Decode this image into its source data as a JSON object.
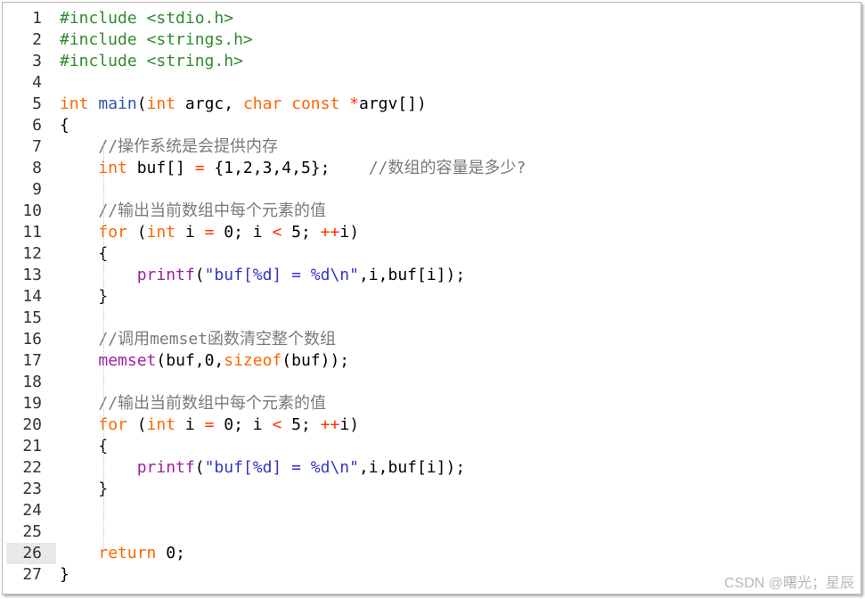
{
  "editor": {
    "lines": [
      {
        "n": "1",
        "tokens": [
          [
            "pp",
            "#include <stdio.h>"
          ]
        ]
      },
      {
        "n": "2",
        "tokens": [
          [
            "pp",
            "#include <strings.h>"
          ]
        ]
      },
      {
        "n": "3",
        "tokens": [
          [
            "pp",
            "#include <string.h>"
          ]
        ]
      },
      {
        "n": "4",
        "tokens": []
      },
      {
        "n": "5",
        "tokens": [
          [
            "kw",
            "int"
          ],
          [
            "t",
            " "
          ],
          [
            "fn",
            "main"
          ],
          [
            "t",
            "("
          ],
          [
            "kw",
            "int"
          ],
          [
            "t",
            " argc, "
          ],
          [
            "kw",
            "char const"
          ],
          [
            "t",
            " "
          ],
          [
            "op",
            "*"
          ],
          [
            "t",
            "argv[])"
          ]
        ]
      },
      {
        "n": "6",
        "tokens": [
          [
            "t",
            "{"
          ]
        ]
      },
      {
        "n": "7",
        "tokens": [
          [
            "t",
            "    "
          ],
          [
            "cm",
            "//操作系统是会提供内存"
          ]
        ]
      },
      {
        "n": "8",
        "tokens": [
          [
            "t",
            "    "
          ],
          [
            "kw",
            "int"
          ],
          [
            "t",
            " buf[] "
          ],
          [
            "op",
            "="
          ],
          [
            "t",
            " {1,2,3,4,5};    "
          ],
          [
            "cm",
            "//数组的容量是多少?"
          ]
        ]
      },
      {
        "n": "9",
        "tokens": []
      },
      {
        "n": "10",
        "tokens": [
          [
            "t",
            "    "
          ],
          [
            "cm",
            "//输出当前数组中每个元素的值"
          ]
        ]
      },
      {
        "n": "11",
        "tokens": [
          [
            "t",
            "    "
          ],
          [
            "kw",
            "for"
          ],
          [
            "t",
            " ("
          ],
          [
            "kw",
            "int"
          ],
          [
            "t",
            " i "
          ],
          [
            "op",
            "="
          ],
          [
            "t",
            " 0; i "
          ],
          [
            "op",
            "<"
          ],
          [
            "t",
            " 5; "
          ],
          [
            "op",
            "++"
          ],
          [
            "t",
            "i)"
          ]
        ]
      },
      {
        "n": "12",
        "tokens": [
          [
            "t",
            "    {"
          ]
        ]
      },
      {
        "n": "13",
        "tokens": [
          [
            "t",
            "        "
          ],
          [
            "call",
            "printf"
          ],
          [
            "t",
            "("
          ],
          [
            "str",
            "\"buf[%d] = %d\\n\""
          ],
          [
            "t",
            ",i,buf[i]);"
          ]
        ]
      },
      {
        "n": "14",
        "tokens": [
          [
            "t",
            "    }"
          ]
        ]
      },
      {
        "n": "15",
        "tokens": []
      },
      {
        "n": "16",
        "tokens": [
          [
            "t",
            "    "
          ],
          [
            "cm",
            "//调用memset函数清空整个数组"
          ]
        ]
      },
      {
        "n": "17",
        "tokens": [
          [
            "t",
            "    "
          ],
          [
            "call",
            "memset"
          ],
          [
            "t",
            "(buf,0,"
          ],
          [
            "kw",
            "sizeof"
          ],
          [
            "t",
            "(buf));"
          ]
        ]
      },
      {
        "n": "18",
        "tokens": []
      },
      {
        "n": "19",
        "tokens": [
          [
            "t",
            "    "
          ],
          [
            "cm",
            "//输出当前数组中每个元素的值"
          ]
        ]
      },
      {
        "n": "20",
        "tokens": [
          [
            "t",
            "    "
          ],
          [
            "kw",
            "for"
          ],
          [
            "t",
            " ("
          ],
          [
            "kw",
            "int"
          ],
          [
            "t",
            " i "
          ],
          [
            "op",
            "="
          ],
          [
            "t",
            " 0; i "
          ],
          [
            "op",
            "<"
          ],
          [
            "t",
            " 5; "
          ],
          [
            "op",
            "++"
          ],
          [
            "t",
            "i)"
          ]
        ]
      },
      {
        "n": "21",
        "tokens": [
          [
            "t",
            "    {"
          ]
        ]
      },
      {
        "n": "22",
        "tokens": [
          [
            "t",
            "        "
          ],
          [
            "call",
            "printf"
          ],
          [
            "t",
            "("
          ],
          [
            "str",
            "\"buf[%d] = %d\\n\""
          ],
          [
            "t",
            ",i,buf[i]);"
          ]
        ]
      },
      {
        "n": "23",
        "tokens": [
          [
            "t",
            "    }"
          ]
        ]
      },
      {
        "n": "24",
        "tokens": []
      },
      {
        "n": "25",
        "tokens": []
      },
      {
        "n": "26",
        "tokens": [
          [
            "t",
            "    "
          ],
          [
            "kw",
            "return"
          ],
          [
            "t",
            " 0;"
          ]
        ]
      },
      {
        "n": "27",
        "tokens": [
          [
            "t",
            "}"
          ]
        ]
      }
    ],
    "highlighted_line": "26",
    "colors": {
      "preprocessor": "#2e8b2e",
      "keyword": "#ff6600",
      "function_def": "#3050b0",
      "function_call": "#a020a0",
      "string": "#3333cc",
      "operator": "#ff3300",
      "comment": "#7a7a7a",
      "current_line_gutter": "#e8e8e8"
    }
  },
  "watermark": "CSDN @曙光；星辰"
}
